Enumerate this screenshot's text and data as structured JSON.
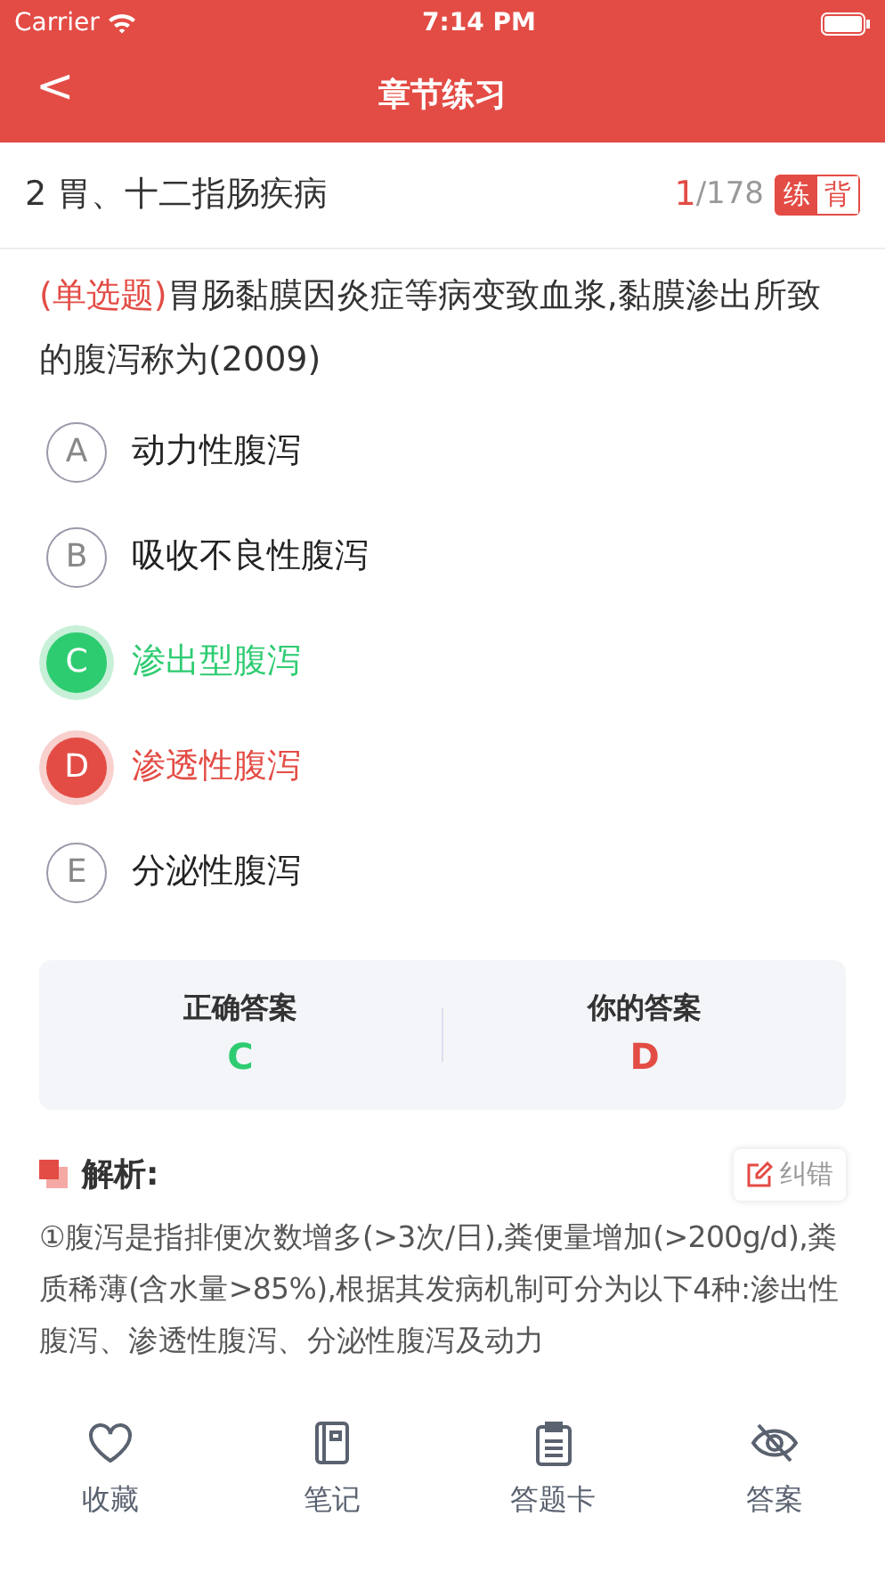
{
  "status_bar": {
    "carrier": "Carrier",
    "time": "7:14 PM"
  },
  "nav": {
    "back": "<",
    "title": "章节练习"
  },
  "chapter": {
    "title": "2 胃、十二指肠疾病",
    "current": "1",
    "total": "/178",
    "modes": [
      {
        "label": "练",
        "selected": true
      },
      {
        "label": "背",
        "selected": false
      }
    ]
  },
  "question": {
    "type": "(单选题)",
    "text": "胃肠黏膜因炎症等病变致血浆,黏膜渗出所致的腹泻称为(2009)"
  },
  "options": [
    {
      "letter": "A",
      "text": "动力性腹泻",
      "selected": false,
      "correct": false
    },
    {
      "letter": "B",
      "text": "吸收不良性腹泻",
      "selected": false,
      "correct": false
    },
    {
      "letter": "C",
      "text": "渗出型腹泻",
      "selected": false,
      "correct": true
    },
    {
      "letter": "D",
      "text": "渗透性腹泻",
      "selected": true,
      "correct": false
    },
    {
      "letter": "E",
      "text": "分泌性腹泻",
      "selected": false,
      "correct": false
    }
  ],
  "answer_card": {
    "correct_label": "正确答案",
    "correct": "C",
    "yours_label": "你的答案",
    "yours": "D"
  },
  "analysis": {
    "title": "解析:",
    "report_button": "纠错",
    "text": "①腹泻是指排便次数增多(>3次/日),粪便量增加(>200g/d),粪质稀薄(含水量>85%),根据其发病机制可分为以下4种:渗出性腹泻、渗透性腹泻、分泌性腹泻及动力"
  },
  "tab_bar": [
    {
      "kind": "heart",
      "label": "收藏"
    },
    {
      "kind": "notebook",
      "label": "笔记"
    },
    {
      "kind": "clipboard",
      "label": "答题卡"
    },
    {
      "kind": "eye-off",
      "label": "答案"
    }
  ]
}
